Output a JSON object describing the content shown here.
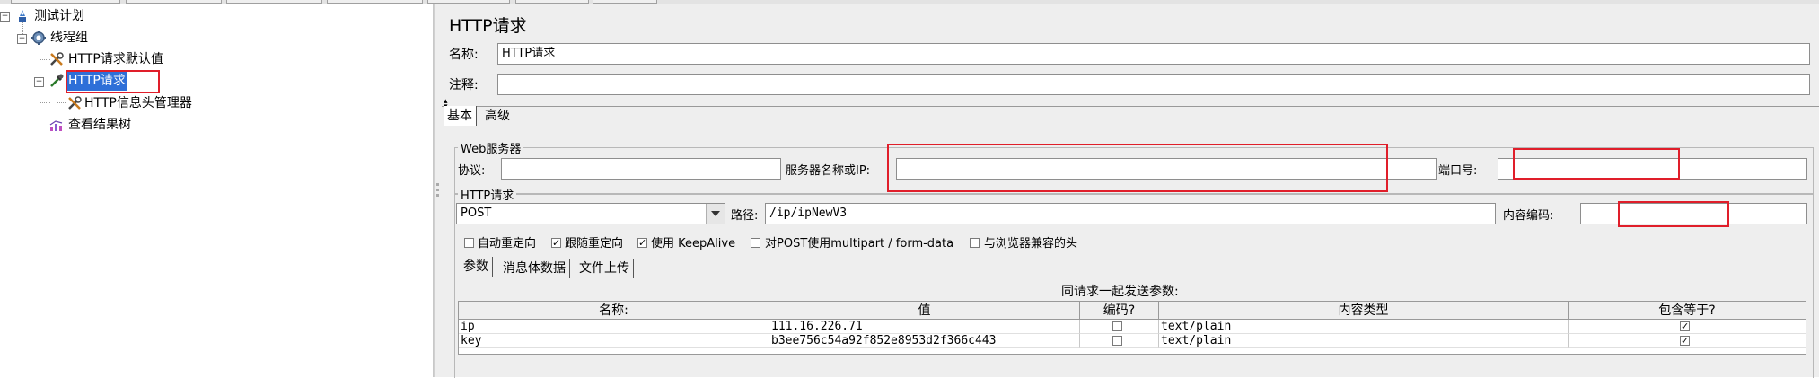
{
  "tree": {
    "nodes": [
      {
        "label": "测试计划",
        "icon": "test-plan-icon"
      },
      {
        "label": "线程组",
        "icon": "gear-icon"
      },
      {
        "label": "HTTP请求默认值",
        "icon": "wrench-icon"
      },
      {
        "label": "HTTP请求",
        "icon": "pipette-icon"
      },
      {
        "label": "HTTP信息头管理器",
        "icon": "wrench-icon"
      },
      {
        "label": "查看结果树",
        "icon": "chart-icon"
      }
    ]
  },
  "panel": {
    "title": "HTTP请求",
    "name_label": "名称:",
    "name_value": "HTTP请求",
    "comment_label": "注释:",
    "comment_value": ""
  },
  "tabs": {
    "basic": "基本",
    "advanced": "高级"
  },
  "web_server": {
    "group_title": "Web服务器",
    "protocol_label": "协议:",
    "protocol_value": "",
    "server_label": "服务器名称或IP:",
    "server_value": "",
    "port_label": "端口号:",
    "port_value": ""
  },
  "http_request": {
    "group_title": "HTTP请求",
    "method": "POST",
    "path_label": "路径:",
    "path_value": "/ip/ipNewV3",
    "encoding_label": "内容编码:",
    "encoding_value": "",
    "options": [
      {
        "label": "自动重定向",
        "checked": false
      },
      {
        "label": "跟随重定向",
        "checked": true
      },
      {
        "label": "使用 KeepAlive",
        "checked": true
      },
      {
        "label": "对POST使用multipart / form-data",
        "checked": false
      },
      {
        "label": "与浏览器兼容的头",
        "checked": false
      }
    ]
  },
  "sub_tabs": {
    "params": "参数",
    "body": "消息体数据",
    "files": "文件上传"
  },
  "params": {
    "caption": "同请求一起发送参数:",
    "columns": [
      "名称:",
      "值",
      "编码?",
      "内容类型",
      "包含等于?"
    ],
    "rows": [
      {
        "name": "ip",
        "value": "111.16.226.71",
        "encode": false,
        "content_type": "text/plain",
        "include_equals": true
      },
      {
        "name": "key",
        "value": "b3ee756c54a92f852e8953d2f366c443",
        "encode": false,
        "content_type": "text/plain",
        "include_equals": true
      }
    ]
  },
  "colors": {
    "selection": "#2e6fd8",
    "annotation_red": "#e01e2a",
    "panel_bg": "#eeeeee"
  }
}
